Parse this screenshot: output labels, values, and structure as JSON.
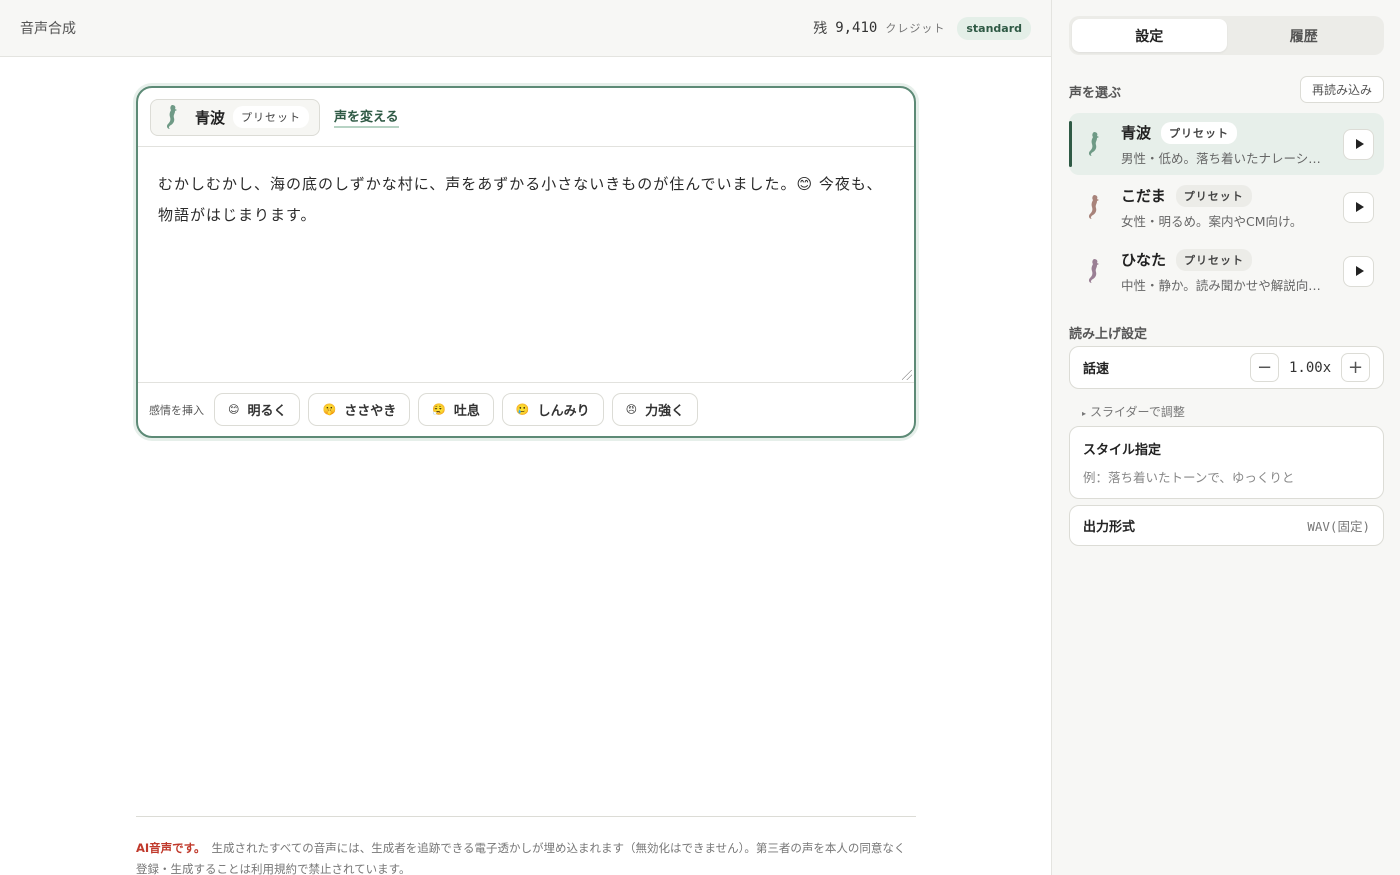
{
  "topbar": {
    "title": "音声合成",
    "credit_prefix": "残",
    "credit_amount": "9,410",
    "credit_unit": "クレジット",
    "plan": "standard"
  },
  "editor": {
    "voice_name": "青波",
    "voice_tag": "プリセット",
    "change_voice_label": "声を変える",
    "text": "むかしむかし、海の底のしずかな村に、声をあずかる小さないきものが住んでいました。😊 今夜も、物語がはじまります。",
    "emotion_label": "感情を挿入",
    "emotions": [
      {
        "face": "😊",
        "label": "明るく"
      },
      {
        "face": "🤫",
        "label": "ささやき"
      },
      {
        "face": "😮‍💨",
        "label": "吐息"
      },
      {
        "face": "🥲",
        "label": "しんみり"
      },
      {
        "face": "😠",
        "label": "力強く"
      }
    ]
  },
  "footer": {
    "warning": "AI音声です。",
    "notice": "生成されたすべての音声には、生成者を追跡できる電子透かしが埋め込まれます（無効化はできません）。第三者の声を本人の同意なく登録・生成することは利用規約で禁止されています。"
  },
  "sidebar": {
    "tabs": [
      {
        "label": "設定"
      },
      {
        "label": "履歴"
      }
    ],
    "voice_section_title": "声を選ぶ",
    "reload_label": "再読み込み",
    "voices": [
      {
        "name": "青波",
        "tag": "プリセット",
        "desc": "男性・低め。落ち着いたナレーション向け。",
        "icon_color": "#6f9a86"
      },
      {
        "name": "こだま",
        "tag": "プリセット",
        "desc": "女性・明るめ。案内やCM向け。",
        "icon_color": "#a8837a"
      },
      {
        "name": "ひなた",
        "tag": "プリセット",
        "desc": "中性・静か。読み聞かせや解説向け。",
        "icon_color": "#9a7f94"
      }
    ],
    "reading_section_title": "読み上げ設定",
    "speed_label": "話速",
    "speed_value": "1.00x",
    "minus_label": "−",
    "plus_label": "+",
    "slider_toggle": "スライダーで調整",
    "style_title": "スタイル指定",
    "style_placeholder": "例：落ち着いたトーンで、ゆっくりと",
    "output_label": "出力形式",
    "output_value": "WAV(固定)"
  }
}
